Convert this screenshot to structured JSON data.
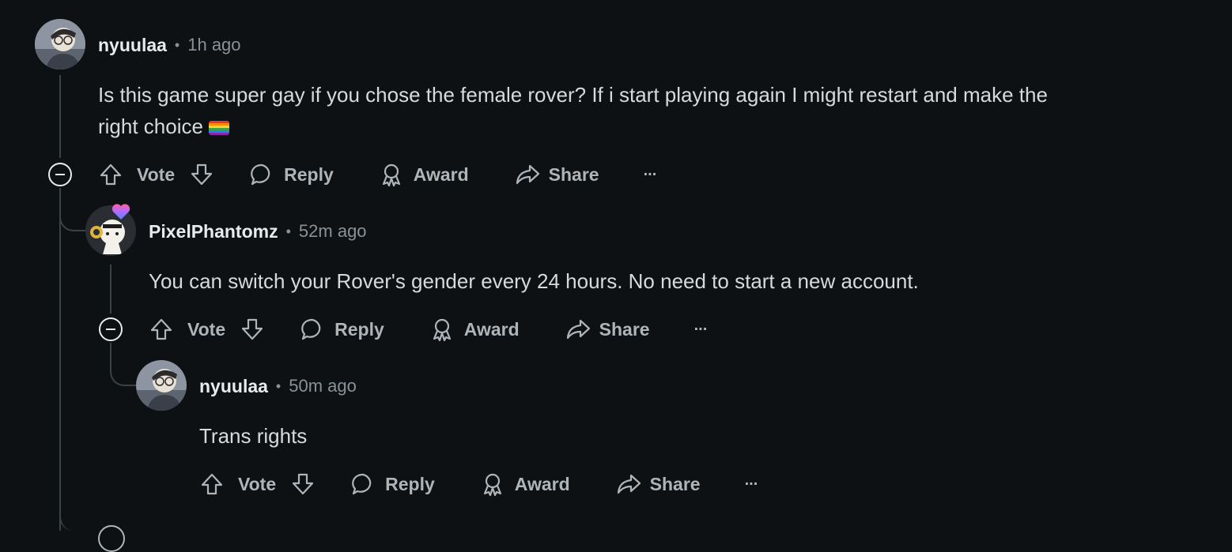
{
  "comments": [
    {
      "username": "nyuulaa",
      "time": "1h ago",
      "text_line1": "Is this game super gay if you chose the female rover? If i start playing again I might restart and make the",
      "text_line2": "right choice",
      "flag_icon": "rainbow-flag-icon"
    },
    {
      "username": "PixelPhantomz",
      "time": "52m ago",
      "text": "You can switch your Rover's gender every 24 hours. No need to start a new account."
    },
    {
      "username": "nyuulaa",
      "time": "50m ago",
      "text": "Trans rights"
    }
  ],
  "actions": {
    "vote": "Vote",
    "reply": "Reply",
    "award": "Award",
    "share": "Share",
    "more": "..."
  },
  "colors": {
    "background": "#0e1113",
    "thread_line": "#3b4246",
    "text": "#d7dadc",
    "muted": "#8a9297",
    "action": "#aeb4b8"
  }
}
